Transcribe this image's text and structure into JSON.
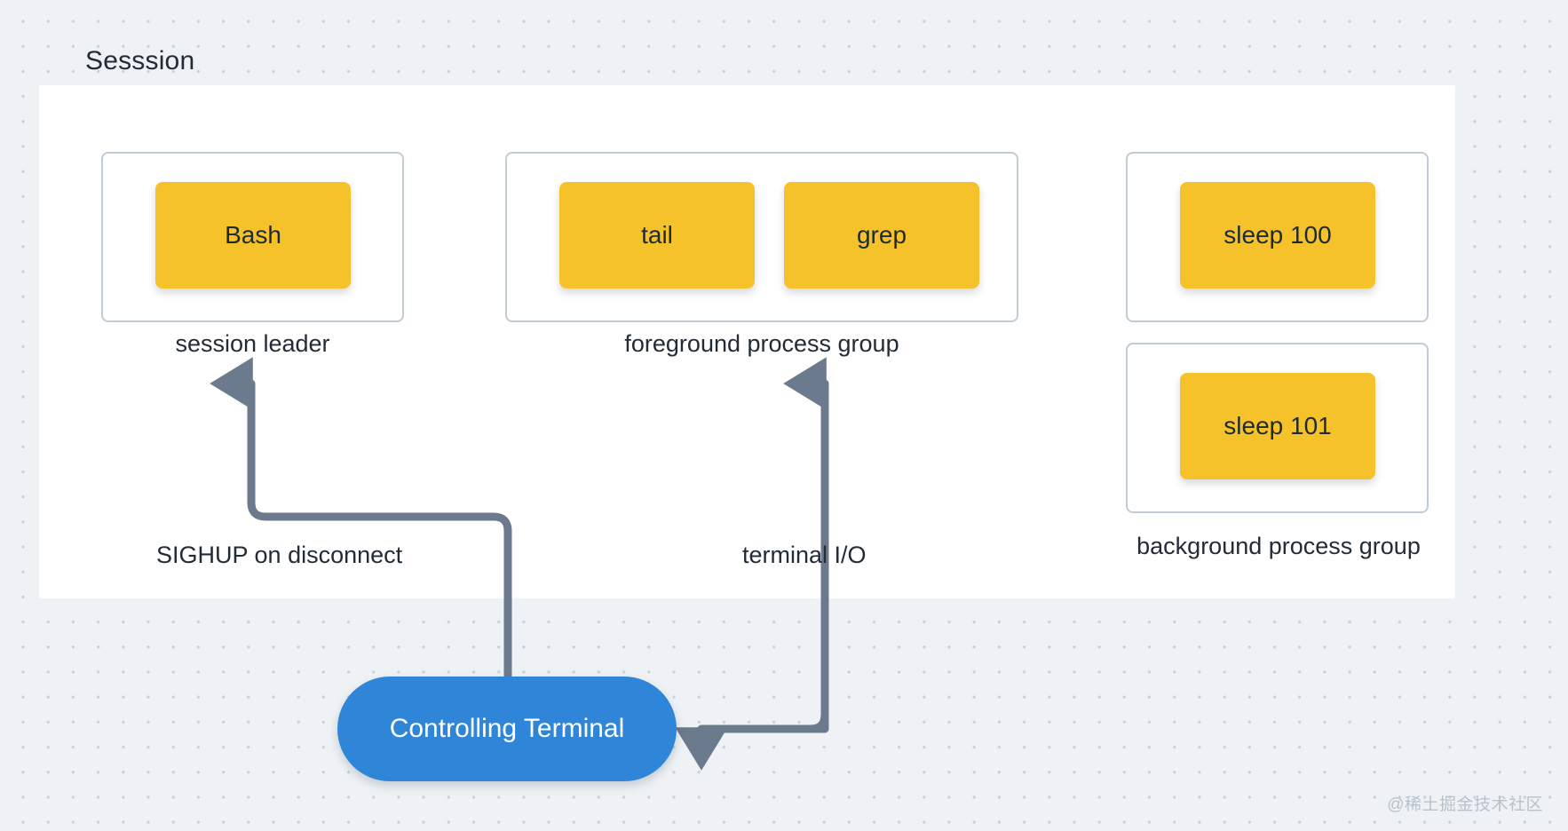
{
  "diagram": {
    "title": "Sesssion",
    "watermark": "@稀土掘金技术社区",
    "colors": {
      "canvas_background": "#eef2f5",
      "grid_dot": "#c9d2da",
      "panel_background": "#ffffff",
      "group_border": "#c2ccd6",
      "process_fill": "#f5c22b",
      "process_text": "#1f2b33",
      "terminal_fill": "#2f86d8",
      "terminal_text": "#ffffff",
      "arrow": "#6b7a8c",
      "label_text": "#222c36"
    }
  },
  "groups": [
    {
      "id": "session-leader",
      "caption": "session leader",
      "processes": [
        {
          "id": "bash",
          "label": "Bash"
        }
      ]
    },
    {
      "id": "foreground",
      "caption": "foreground process group",
      "processes": [
        {
          "id": "tail",
          "label": "tail"
        },
        {
          "id": "grep",
          "label": "grep"
        }
      ]
    },
    {
      "id": "background",
      "caption": "background process group",
      "processes": [
        {
          "id": "sleep-100",
          "label": "sleep 100"
        },
        {
          "id": "sleep-101",
          "label": "sleep 101"
        }
      ]
    }
  ],
  "terminal": {
    "label": "Controlling Terminal"
  },
  "edges": [
    {
      "id": "sighup",
      "label": "SIGHUP on disconnect",
      "from": "Controlling Terminal",
      "to": "session leader"
    },
    {
      "id": "terminal-io",
      "label": "terminal I/O",
      "from": "Controlling Terminal",
      "to": "foreground process group"
    }
  ]
}
